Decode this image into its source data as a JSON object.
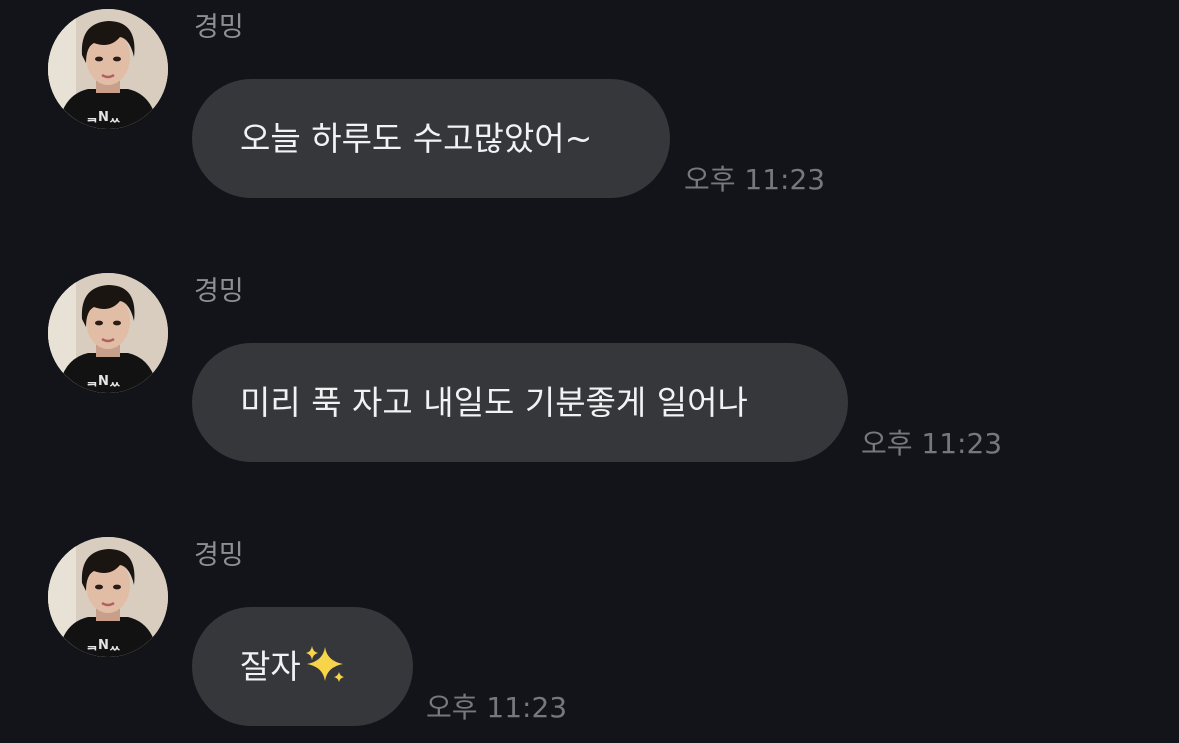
{
  "colors": {
    "background": "#131419",
    "bubble": "#36373b",
    "message_text": "#f2f2f4",
    "sender_name": "#8e8e93",
    "timestamp": "#77777c",
    "sparkle": "#f7d44a"
  },
  "messages": [
    {
      "sender": "경밍",
      "text": "오늘 하루도 수고많았어~",
      "time": "오후 11:23",
      "avatar_icon": "profile-photo-avatar"
    },
    {
      "sender": "경밍",
      "text": "미리 푹 자고 내일도 기분좋게 일어나",
      "time": "오후 11:23",
      "avatar_icon": "profile-photo-avatar"
    },
    {
      "sender": "경밍",
      "text": "잘자",
      "emoji_icon": "sparkles-icon",
      "time": "오후 11:23",
      "avatar_icon": "profile-photo-avatar"
    }
  ]
}
